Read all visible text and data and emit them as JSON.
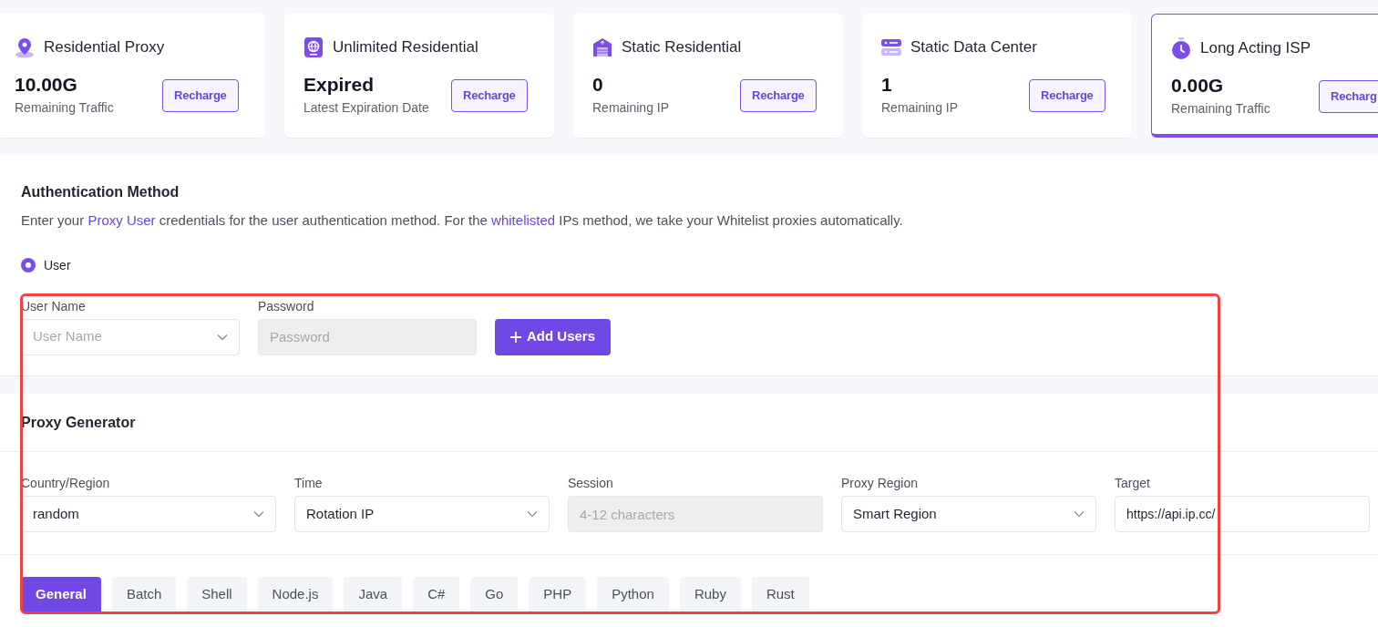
{
  "products": [
    {
      "title": "Residential Proxy",
      "value": "10.00G",
      "caption": "Remaining Traffic",
      "button": "Recharge",
      "selected": false
    },
    {
      "title": "Unlimited Residential",
      "value": "Expired",
      "caption": "Latest Expiration Date",
      "button": "Recharge",
      "selected": false
    },
    {
      "title": "Static Residential",
      "value": "0",
      "caption": "Remaining IP",
      "button": "Recharge",
      "selected": false
    },
    {
      "title": "Static Data Center",
      "value": "1",
      "caption": "Remaining IP",
      "button": "Recharge",
      "selected": false
    },
    {
      "title": "Long Acting ISP",
      "value": "0.00G",
      "caption": "Remaining Traffic",
      "button": "Recharg",
      "selected": true
    }
  ],
  "authentication": {
    "title": "Authentication Method",
    "description": [
      {
        "text": "Enter your ",
        "link": false
      },
      {
        "text": "Proxy User",
        "link": true
      },
      {
        "text": " credentials for the user authentication method. For the ",
        "link": false
      },
      {
        "text": "whitelisted",
        "link": true
      },
      {
        "text": " IPs method, we take your Whitelist proxies automatically.",
        "link": false
      }
    ],
    "options": [
      {
        "label": "User",
        "selected": true
      }
    ],
    "fields": [
      {
        "kind": "select",
        "label": "User Name",
        "placeholder": "User Name"
      },
      {
        "kind": "disabled",
        "label": "Password",
        "placeholder": "Password"
      }
    ],
    "add_button": "Add Users"
  },
  "generator": {
    "title": "Proxy Generator",
    "fields": [
      {
        "kind": "select",
        "label": "Country/Region",
        "value": "random"
      },
      {
        "kind": "select",
        "label": "Time",
        "value": "Rotation IP"
      },
      {
        "kind": "disabled",
        "label": "Session",
        "placeholder": "4-12 characters"
      },
      {
        "kind": "select",
        "label": "Proxy Region",
        "value": "Smart Region"
      },
      {
        "kind": "text",
        "label": "Target",
        "value": "https://api.ip.cc/"
      }
    ],
    "tabs": [
      {
        "label": "General",
        "selected": true
      },
      {
        "label": "Batch",
        "selected": false
      },
      {
        "label": "Shell",
        "selected": false
      },
      {
        "label": "Node.js",
        "selected": false
      },
      {
        "label": "Java",
        "selected": false
      },
      {
        "label": "C#",
        "selected": false
      },
      {
        "label": "Go",
        "selected": false
      },
      {
        "label": "PHP",
        "selected": false
      },
      {
        "label": "Python",
        "selected": false
      },
      {
        "label": "Ruby",
        "selected": false
      },
      {
        "label": "Rust",
        "selected": false
      }
    ]
  },
  "highlight": {
    "shown": true
  }
}
